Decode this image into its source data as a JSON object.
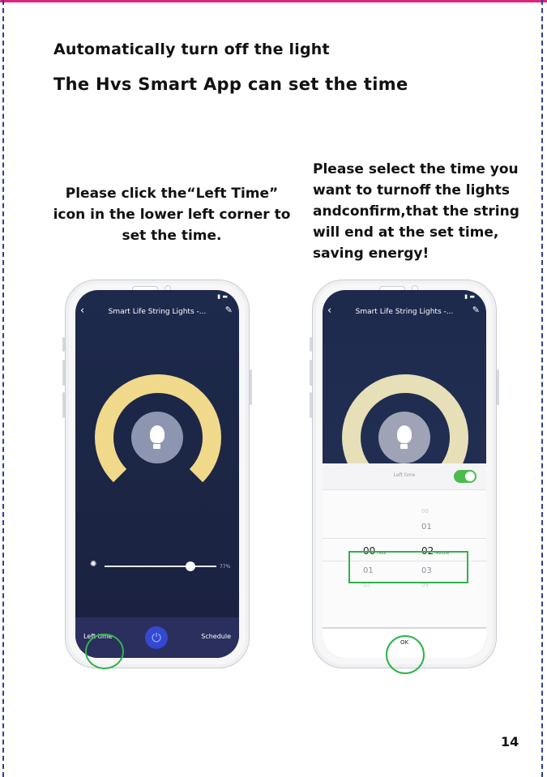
{
  "heading": {
    "line1": "Automatically turn off the light",
    "line2": "The  Hvs Smart  App can set the time"
  },
  "captions": {
    "left": "Please click the“Left  Time” icon in the lower left corner to set the time.",
    "right": "Please select the time you want to turnoff the lights andconfirm,that the string will end at the set time, saving energy!"
  },
  "phone_left": {
    "title": "Smart Life String Lights",
    "title_suffix": "-...",
    "slider_value": "77%",
    "slider_level": 0.77,
    "bottom_left": "Left time",
    "bottom_right": "Schedule"
  },
  "phone_right": {
    "title": "Smart Life String Lights",
    "title_suffix": "-...",
    "sheet_label": "Left time",
    "hours": {
      "above2": "",
      "above1": "",
      "selected": "00",
      "below1": "01",
      "below2": "02"
    },
    "minutes": {
      "above2": "00",
      "above1": "01",
      "selected": "02",
      "below1": "03",
      "below2": "04"
    },
    "hour_unit": "Hour",
    "minute_unit": "Minute",
    "ok": "OK"
  },
  "page_number": "14",
  "colors": {
    "accent_green": "#2fb34a",
    "ring": "#f1d98b",
    "app_bg": "#1d2a4c",
    "top_rule": "#e0257a"
  }
}
